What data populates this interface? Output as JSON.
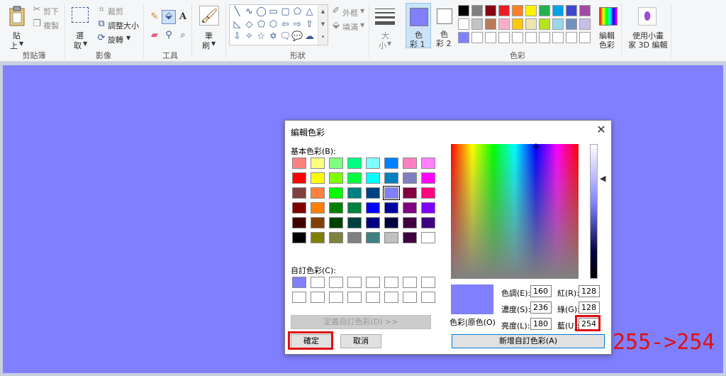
{
  "ribbon": {
    "clipboard": {
      "paste": "貼",
      "paste2": "上",
      "cut": "剪下",
      "copy": "複製",
      "group": "剪貼簿"
    },
    "image": {
      "select": "選",
      "select2": "取",
      "crop": "裁剪",
      "resize": "調整大小",
      "rotate": "旋轉",
      "group": "影像"
    },
    "tools": {
      "group": "工具"
    },
    "brush": {
      "label": "筆",
      "label2": "刷"
    },
    "shapes": {
      "outline": "外框",
      "fill": "填滿",
      "group": "形狀"
    },
    "size": {
      "label": "大",
      "label2": "小"
    },
    "color1": {
      "label": "色",
      "label2": "彩 1",
      "value": "#8080ff"
    },
    "color2": {
      "label": "色",
      "label2": "彩 2",
      "value": "#ffffff"
    },
    "palette_row1": [
      "#000000",
      "#7f7f7f",
      "#880015",
      "#ed1c24",
      "#ff7f27",
      "#fff200",
      "#22b14c",
      "#00a2e8",
      "#3f48cc",
      "#a349a4"
    ],
    "palette_row2": [
      "#ffffff",
      "#c3c3c3",
      "#b97a57",
      "#ffaec9",
      "#ffc90e",
      "#efe4b0",
      "#b5e61d",
      "#99d9ea",
      "#7092be",
      "#c8bfe7"
    ],
    "palette_row3": [
      "#8080ff",
      "#ffffff",
      "#ffffff",
      "#ffffff",
      "#ffffff",
      "#ffffff",
      "#ffffff",
      "#ffffff",
      "#ffffff",
      "#ffffff"
    ],
    "colors_group": "色彩",
    "edit_colors": {
      "label": "編輯",
      "label2": "色彩"
    },
    "paint3d": {
      "label": "使用小畫",
      "label2": "家 3D 編輯"
    }
  },
  "dialog": {
    "title": "編輯色彩",
    "basic_label": "基本色彩(B):",
    "basic_colors": [
      [
        "#ff8080",
        "#ffff80",
        "#80ff80",
        "#00ff80",
        "#80ffff",
        "#0080ff",
        "#ff80c0",
        "#ff80ff"
      ],
      [
        "#ff0000",
        "#ffff00",
        "#80ff00",
        "#00ff40",
        "#00ffff",
        "#0080c0",
        "#8080c0",
        "#ff00ff"
      ],
      [
        "#804040",
        "#ff8040",
        "#00ff00",
        "#008080",
        "#004080",
        "#8080ff",
        "#800040",
        "#ff0080"
      ],
      [
        "#800000",
        "#ff8000",
        "#008000",
        "#008040",
        "#0000ff",
        "#0000a0",
        "#800080",
        "#8000ff"
      ],
      [
        "#400000",
        "#804000",
        "#004000",
        "#004040",
        "#000080",
        "#000040",
        "#400040",
        "#400080"
      ],
      [
        "#000000",
        "#808000",
        "#808040",
        "#808080",
        "#408080",
        "#c0c0c0",
        "#400040",
        "#ffffff"
      ]
    ],
    "custom_label": "自訂色彩(C):",
    "custom_colors": [
      [
        "#8080ff",
        "#ffffff",
        "#ffffff",
        "#ffffff",
        "#ffffff",
        "#ffffff",
        "#ffffff",
        "#ffffff"
      ],
      [
        "#ffffff",
        "#ffffff",
        "#ffffff",
        "#ffffff",
        "#ffffff",
        "#ffffff",
        "#ffffff",
        "#ffffff"
      ]
    ],
    "define_custom": "定義自訂色彩(D) >>",
    "ok": "確定",
    "cancel": "取消",
    "color_solid": "色彩|原色(O)",
    "preview_color": "#8080fe",
    "hue_label": "色調(E):",
    "hue": "160",
    "sat_label": "濃度(S):",
    "sat": "236",
    "lum_label": "亮度(L):",
    "lum": "180",
    "red_label": "紅(R):",
    "red": "128",
    "green_label": "綠(G):",
    "green": "128",
    "blue_label": "藍(U):",
    "blue": "254",
    "add_custom": "新增自訂色彩(A)"
  },
  "annotation": "255->254"
}
